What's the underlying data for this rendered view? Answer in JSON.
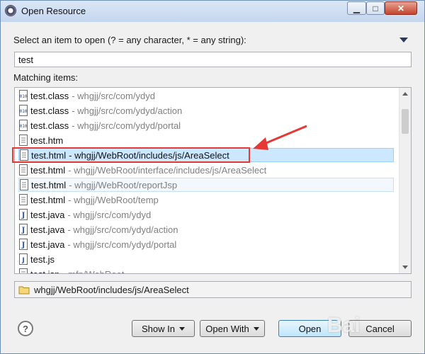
{
  "window": {
    "title": "Open Resource",
    "minimize_glyph": "▁",
    "maximize_glyph": "□",
    "close_glyph": "✕"
  },
  "dialog": {
    "prompt": "Select an item to open (? = any character, * = any string):",
    "filter_value": "test",
    "matching_label": "Matching items:"
  },
  "items": [
    {
      "name": "test.class",
      "path": "- whgjj/src/com/ydyd",
      "icon": "class-file-icon",
      "state": "normal"
    },
    {
      "name": "test.class",
      "path": "- whgjj/src/com/ydyd/action",
      "icon": "class-file-icon",
      "state": "normal"
    },
    {
      "name": "test.class",
      "path": "- whgjj/src/com/ydyd/portal",
      "icon": "class-file-icon",
      "state": "normal"
    },
    {
      "name": "test.htm",
      "path": "",
      "icon": "text-file-icon",
      "state": "normal"
    },
    {
      "name": "test.html",
      "path": "- whgjj/WebRoot/includes/js/AreaSelect",
      "icon": "text-file-icon",
      "state": "selected"
    },
    {
      "name": "test.html",
      "path": "- whgjj/WebRoot/interface/includes/js/AreaSelect",
      "icon": "text-file-icon",
      "state": "normal"
    },
    {
      "name": "test.html",
      "path": "- whgjj/WebRoot/reportJsp",
      "icon": "text-file-icon",
      "state": "hover"
    },
    {
      "name": "test.html",
      "path": "- whgjj/WebRoot/temp",
      "icon": "text-file-icon",
      "state": "normal"
    },
    {
      "name": "test.java",
      "path": "- whgjj/src/com/ydyd",
      "icon": "java-file-icon",
      "state": "normal"
    },
    {
      "name": "test.java",
      "path": "- whgjj/src/com/ydyd/action",
      "icon": "java-file-icon",
      "state": "normal"
    },
    {
      "name": "test.java",
      "path": "- whgjj/src/com/ydyd/portal",
      "icon": "java-file-icon",
      "state": "normal"
    },
    {
      "name": "test.js",
      "path": "",
      "icon": "js-file-icon",
      "state": "normal"
    },
    {
      "name": "test.jsp",
      "path": "- mfp/WebRoot",
      "icon": "text-file-icon",
      "state": "normal"
    }
  ],
  "status": {
    "path": "whgjj/WebRoot/includes/js/AreaSelect",
    "icon": "folder-icon"
  },
  "buttons": {
    "help": "?",
    "show_in": "Show In",
    "open_with": "Open With",
    "open": "Open",
    "cancel": "Cancel"
  },
  "watermark": "Bai",
  "colors": {
    "selection_bg": "#cce8ff",
    "selection_border": "#99d1ff",
    "annotation_red": "#e53935",
    "path_gray": "#808080"
  }
}
